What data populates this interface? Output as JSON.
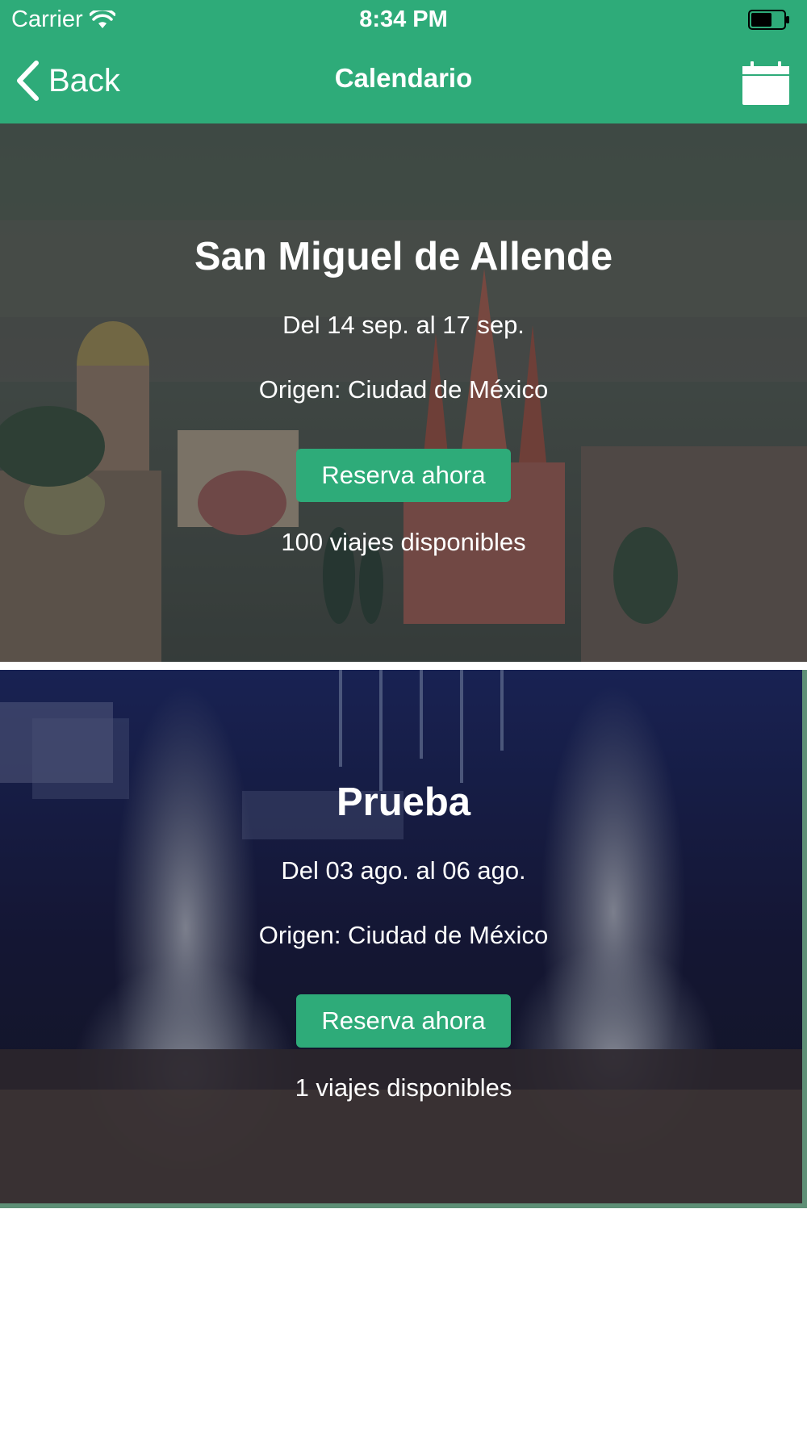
{
  "status_bar": {
    "carrier": "Carrier",
    "time": "8:34 PM",
    "icons": [
      "wifi-icon",
      "battery-icon"
    ]
  },
  "nav": {
    "back_label": "Back",
    "title": "Calendario",
    "right_icon": "calendar-icon"
  },
  "colors": {
    "brand_green": "#2eab79",
    "card_border": "#5e8f76"
  },
  "trips": [
    {
      "title": "San Miguel de Allende",
      "dates": "Del 14 sep. al 17 sep.",
      "origin": "Origen: Ciudad de México",
      "button_label": "Reserva ahora",
      "availability": "100 viajes disponibles"
    },
    {
      "title": "Prueba",
      "dates": "Del 03 ago. al 06 ago.",
      "origin": "Origen: Ciudad de México",
      "button_label": "Reserva ahora",
      "availability": "1 viajes disponibles"
    }
  ]
}
